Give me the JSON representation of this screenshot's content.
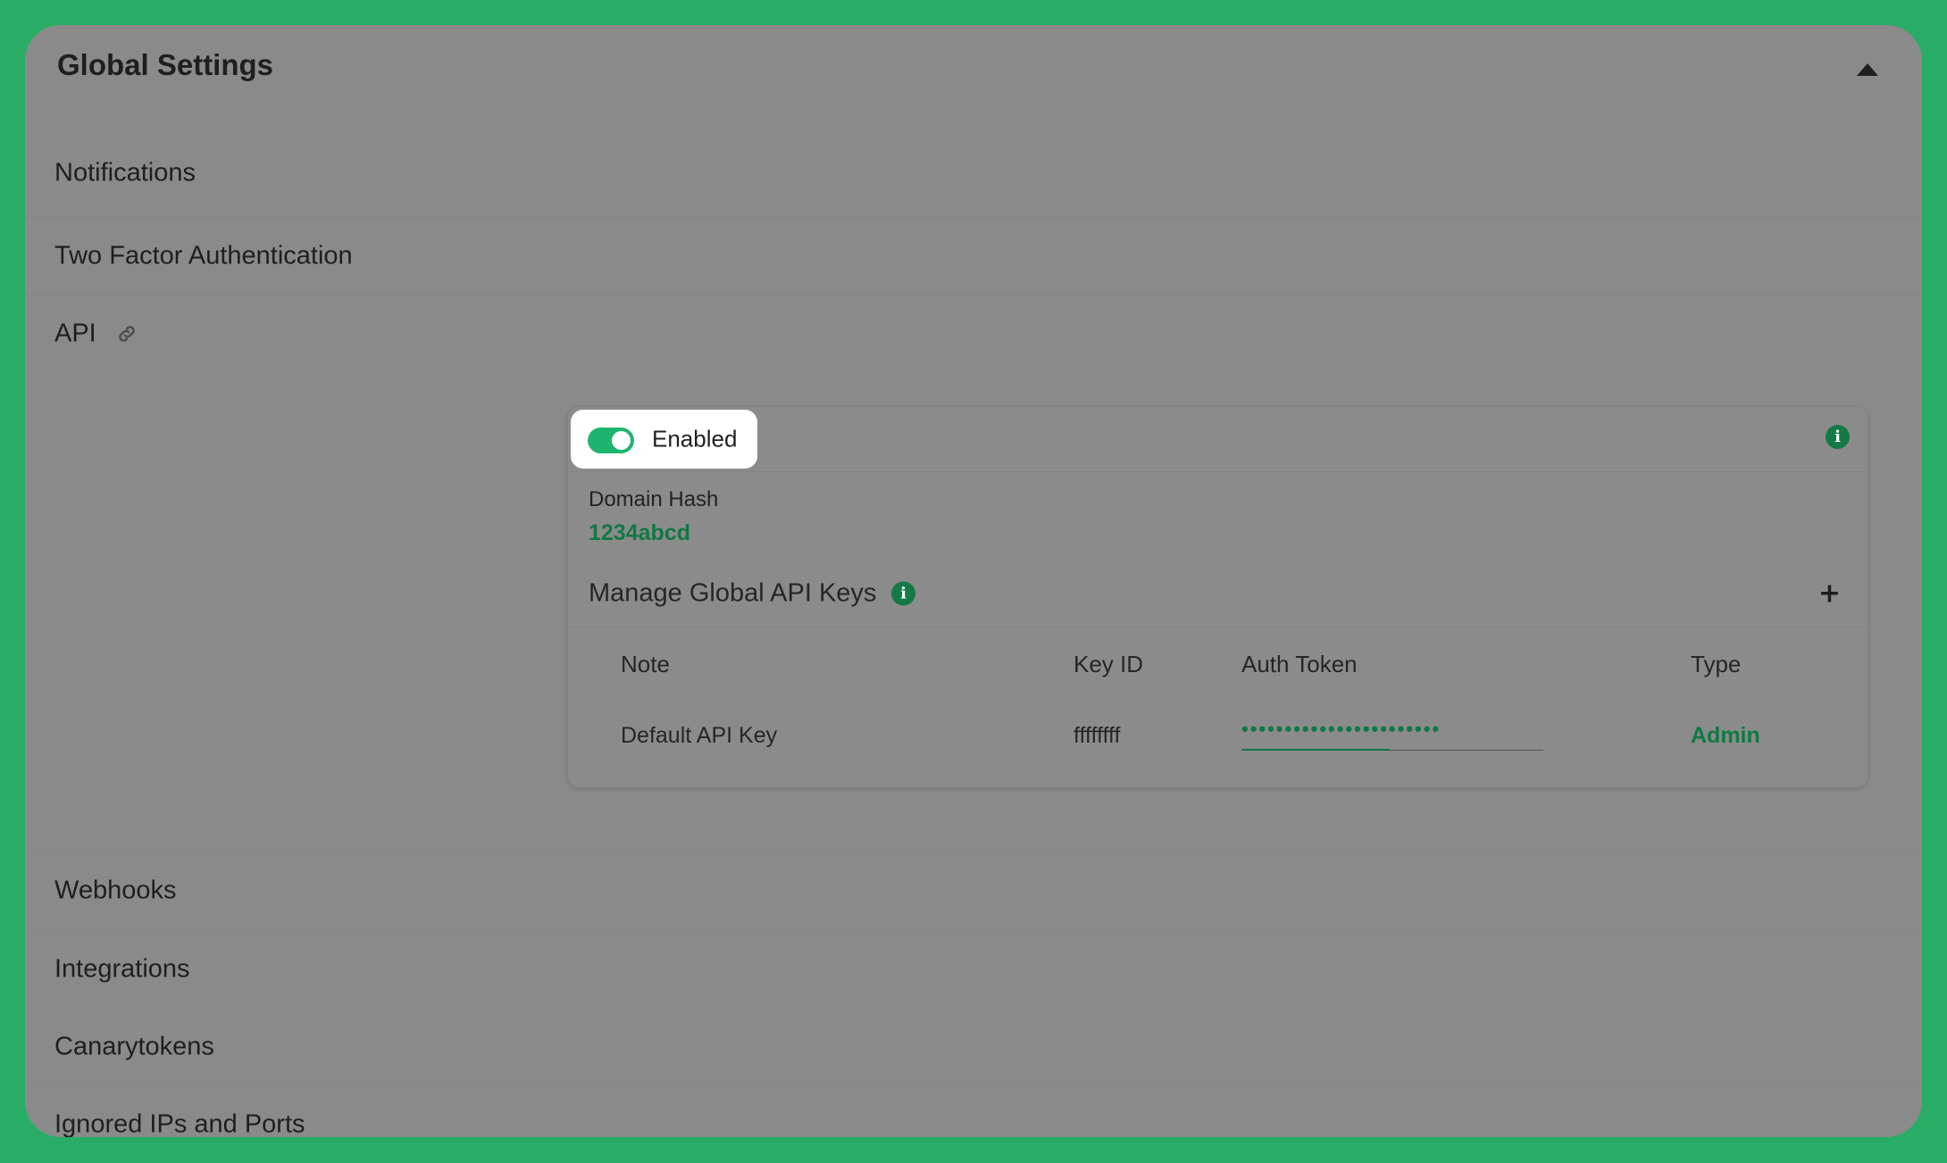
{
  "panel": {
    "title": "Global Settings",
    "collapse_icon": "chevron-up-icon"
  },
  "sections": {
    "notifications": "Notifications",
    "two_factor": "Two Factor Authentication",
    "api": "API",
    "webhooks": "Webhooks",
    "integrations": "Integrations",
    "canarytokens": "Canarytokens",
    "ignored": "Ignored IPs and Ports"
  },
  "api": {
    "link_icon": "link-icon",
    "toggle": {
      "label": "Enabled",
      "on": true
    },
    "domain_hash": {
      "label": "Domain Hash",
      "value": "1234abcd"
    },
    "keys": {
      "title": "Manage Global API Keys",
      "columns": [
        "Note",
        "Key ID",
        "Auth Token",
        "Type"
      ],
      "rows": [
        {
          "note": "Default API Key",
          "key_id": "ffffffff",
          "auth_token": "•••••••••••••••••••••••",
          "type": "Admin"
        }
      ]
    }
  },
  "colors": {
    "background": "#29ad66",
    "panel": "#8a8a8a",
    "accent": "#0f7a43",
    "toggle_on": "#1fb46d"
  }
}
